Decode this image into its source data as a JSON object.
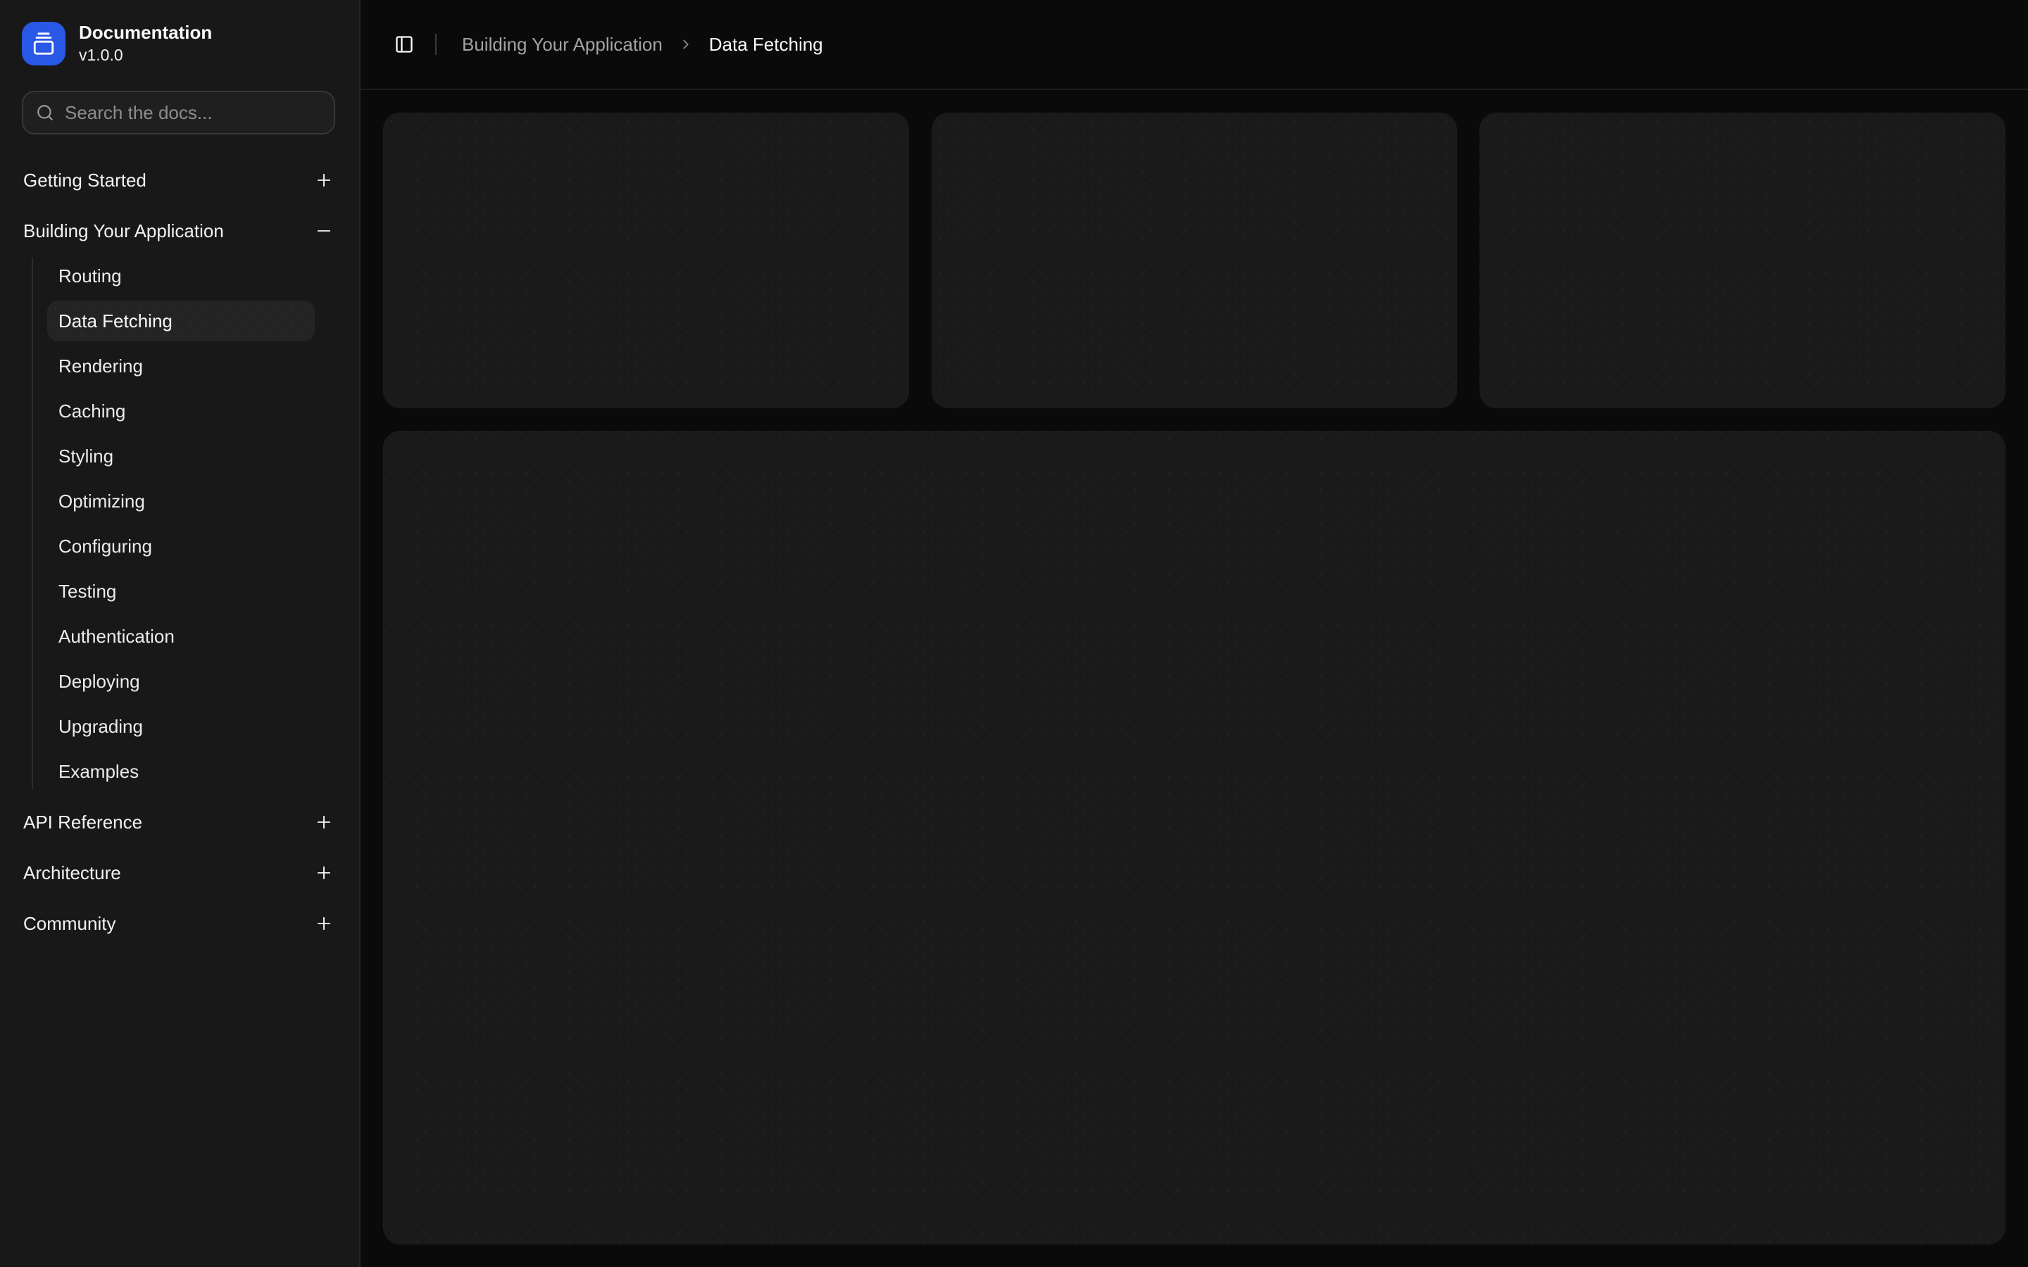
{
  "app": {
    "title": "Documentation",
    "version": "v1.0.0"
  },
  "search": {
    "placeholder": "Search the docs..."
  },
  "sidebar": {
    "sections": [
      {
        "label": "Getting Started",
        "expanded": false,
        "toggle_icon": "plus-icon"
      },
      {
        "label": "Building Your Application",
        "expanded": true,
        "toggle_icon": "minus-icon",
        "items": [
          {
            "label": "Routing",
            "active": false
          },
          {
            "label": "Data Fetching",
            "active": true
          },
          {
            "label": "Rendering",
            "active": false
          },
          {
            "label": "Caching",
            "active": false
          },
          {
            "label": "Styling",
            "active": false
          },
          {
            "label": "Optimizing",
            "active": false
          },
          {
            "label": "Configuring",
            "active": false
          },
          {
            "label": "Testing",
            "active": false
          },
          {
            "label": "Authentication",
            "active": false
          },
          {
            "label": "Deploying",
            "active": false
          },
          {
            "label": "Upgrading",
            "active": false
          },
          {
            "label": "Examples",
            "active": false
          }
        ]
      },
      {
        "label": "API Reference",
        "expanded": false,
        "toggle_icon": "plus-icon"
      },
      {
        "label": "Architecture",
        "expanded": false,
        "toggle_icon": "plus-icon"
      },
      {
        "label": "Community",
        "expanded": false,
        "toggle_icon": "plus-icon"
      }
    ],
    "active_item": "Data Fetching"
  },
  "header": {
    "breadcrumb": {
      "parent": "Building Your Application",
      "current": "Data Fetching"
    }
  },
  "icons": {
    "logo": "gallery-vertical-end",
    "search": "magnifier",
    "sidebar_trigger": "panel-left",
    "breadcrumb_separator": "chevron-right",
    "collapsed_section": "plus",
    "expanded_section": "minus"
  },
  "colors": {
    "page_bg": "#0a0a0a",
    "sidebar_bg": "#181818",
    "card_bg": "#1a1a1a",
    "active_item_bg": "#242424",
    "accent_blue": "#2a58e6",
    "text_primary": "#fafafa",
    "text_muted": "#a3a3a3"
  }
}
